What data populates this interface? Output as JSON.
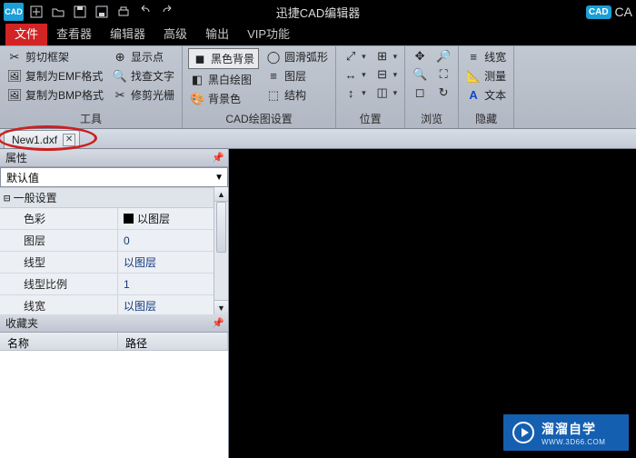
{
  "titlebar": {
    "app_icon_text": "CAD",
    "title": "迅捷CAD编辑器",
    "right_badge": "CAD",
    "right_text": "CA"
  },
  "menu": {
    "items": [
      {
        "label": "文件",
        "active": true
      },
      {
        "label": "查看器",
        "active": false
      },
      {
        "label": "编辑器",
        "active": false
      },
      {
        "label": "高级",
        "active": false
      },
      {
        "label": "输出",
        "active": false
      },
      {
        "label": "VIP功能",
        "active": false
      }
    ]
  },
  "ribbon": {
    "groups": [
      {
        "title": "工具",
        "cols": [
          [
            {
              "icon": "✂︎",
              "icon_name": "crop-icon",
              "label": "剪切框架"
            },
            {
              "icon": "🖼",
              "icon_name": "emf-icon",
              "label": "复制为EMF格式"
            },
            {
              "icon": "🖼",
              "icon_name": "bmp-icon",
              "label": "复制为BMP格式"
            }
          ],
          [
            {
              "icon": "⊕",
              "icon_name": "show-point-icon",
              "label": "显示点"
            },
            {
              "icon": "🔍",
              "icon_name": "search-icon",
              "label": "找查文字"
            },
            {
              "icon": "✂︎",
              "icon_name": "trim-icon",
              "label": "修剪光栅"
            }
          ]
        ]
      },
      {
        "title": "CAD绘图设置",
        "cols": [
          [
            {
              "icon": "◼",
              "icon_name": "black-bg-icon",
              "label": "黑色背景",
              "boxed": true
            },
            {
              "icon": "◧",
              "icon_name": "bw-draw-icon",
              "label": "黑白绘图"
            },
            {
              "icon": "🎨",
              "icon_name": "bg-color-icon",
              "label": "背景色"
            }
          ],
          [
            {
              "icon": "◯",
              "icon_name": "smooth-arc-icon",
              "label": "圆滑弧形"
            },
            {
              "icon": "≡",
              "icon_name": "layers-icon",
              "label": "图层"
            },
            {
              "icon": "⬚",
              "icon_name": "structure-icon",
              "label": "结构"
            }
          ]
        ]
      },
      {
        "title": "位置",
        "single_row_icons": true,
        "cols": [
          [
            {
              "icon": "⤢",
              "icon_name": "pos1-icon",
              "dd": true
            },
            {
              "icon": "↔",
              "icon_name": "pos2-icon",
              "dd": true
            },
            {
              "icon": "↕",
              "icon_name": "pos3-icon",
              "dd": true
            }
          ],
          [
            {
              "icon": "⊞",
              "icon_name": "pos4-icon",
              "dd": true
            },
            {
              "icon": "⊟",
              "icon_name": "pos5-icon",
              "dd": true
            },
            {
              "icon": "◫",
              "icon_name": "pos6-icon",
              "dd": true
            }
          ]
        ]
      },
      {
        "title": "浏览",
        "single_row_icons": true,
        "cols": [
          [
            {
              "icon": "✥",
              "icon_name": "pan-icon"
            },
            {
              "icon": "🔍",
              "icon_name": "zoom-in-icon"
            },
            {
              "icon": "◻",
              "icon_name": "zoom-rect-icon"
            }
          ],
          [
            {
              "icon": "🔎",
              "icon_name": "zoom-out-icon"
            },
            {
              "icon": "⛶",
              "icon_name": "fit-icon"
            },
            {
              "icon": "↻",
              "icon_name": "orbit-icon"
            }
          ]
        ]
      },
      {
        "title": "隐藏",
        "cols": [
          [
            {
              "icon": "≡",
              "icon_name": "linewidth-icon",
              "label": "线宽"
            },
            {
              "icon": "📐",
              "icon_name": "measure-icon",
              "label": "测量"
            },
            {
              "icon": "A",
              "icon_name": "text-icon",
              "label": "文本",
              "blue": true
            }
          ]
        ]
      }
    ]
  },
  "doc_tabs": {
    "tabs": [
      {
        "label": "New1.dxf"
      }
    ]
  },
  "properties": {
    "title": "属性",
    "dropdown_value": "默认值",
    "section": "一般设置",
    "rows": [
      {
        "key": "色彩",
        "val": "以图层",
        "swatch": true
      },
      {
        "key": "图层",
        "val": "0"
      },
      {
        "key": "线型",
        "val": "以图层"
      },
      {
        "key": "线型比例",
        "val": "1"
      },
      {
        "key": "线宽",
        "val": "以图层"
      }
    ]
  },
  "favorites": {
    "title": "收藏夹",
    "cols": {
      "name": "名称",
      "path": "路径"
    }
  },
  "watermark": {
    "main": "溜溜自学",
    "sub": "WWW.3D66.COM"
  }
}
